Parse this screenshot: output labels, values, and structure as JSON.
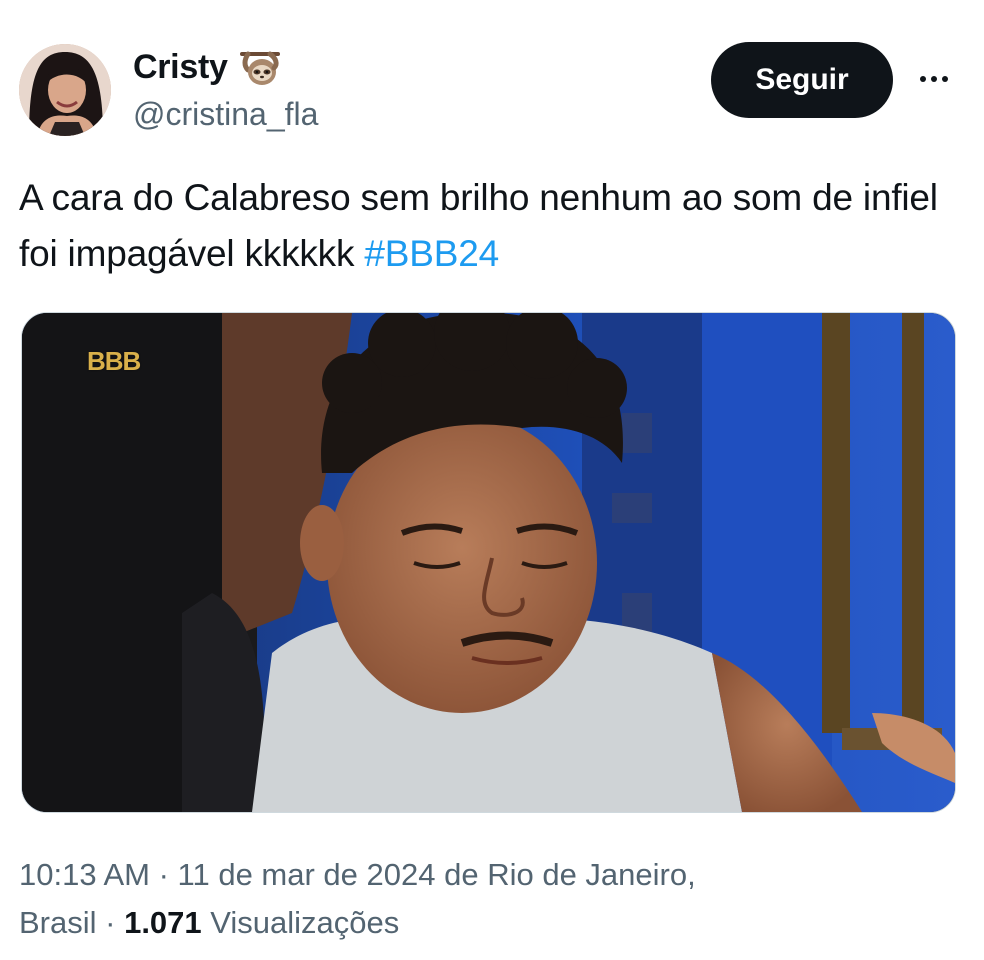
{
  "author": {
    "display_name": "Cristy",
    "handle": "@cristina_fla",
    "name_emoji": "sloth-icon"
  },
  "follow_button_label": "Seguir",
  "more_menu_icon": "more-horizontal-icon",
  "tweet": {
    "text": "A cara do Calabreso sem brilho nenhum ao som de infiel foi impagável kkkkkk ",
    "hashtag": "#BBB24"
  },
  "media": {
    "watermark": "BBB"
  },
  "meta": {
    "time": "10:13 AM",
    "separator": " · ",
    "date": "11 de mar de 2024",
    "location": " de Rio de Janeiro,",
    "location_cont": "Brasil",
    "views_count": "1.071",
    "views_label": " Visualizações"
  },
  "colors": {
    "text_primary": "#0f1419",
    "text_secondary": "#536471",
    "link": "#1d9bf0",
    "button_bg": "#0f1419"
  }
}
